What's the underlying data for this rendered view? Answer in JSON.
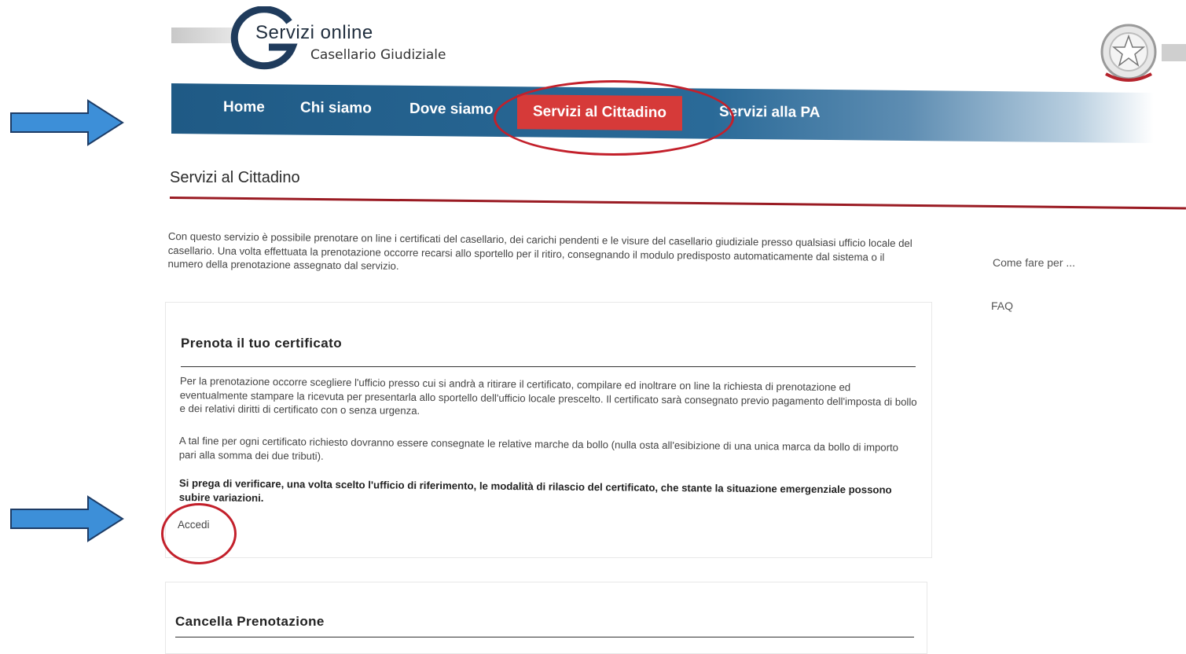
{
  "colors": {
    "nav_blue": "#1f5a85",
    "active_red": "#d63a39",
    "rule_red": "#9a1b23",
    "annotation_red": "#c3202b",
    "arrow_blue": "#3d8fd8"
  },
  "header": {
    "logo_title": "Servizi online",
    "logo_subtitle": "Casellario Giudiziale",
    "logo_icon": "g-logo-icon",
    "emblem_icon": "italian-republic-emblem-icon"
  },
  "nav": {
    "items": [
      {
        "label": "Home"
      },
      {
        "label": "Chi siamo"
      },
      {
        "label": "Dove siamo"
      },
      {
        "label": "Servizi al Cittadino",
        "active": true
      },
      {
        "label": "Servizi alla PA"
      }
    ]
  },
  "page": {
    "title": "Servizi al Cittadino",
    "intro": "Con questo servizio è possibile prenotare on line i certificati del casellario, dei carichi pendenti e le visure del casellario giudiziale presso qualsiasi ufficio locale del casellario. Una volta effettuata la prenotazione occorre recarsi allo sportello per il ritiro, consegnando il modulo predisposto automaticamente dal sistema o il numero della prenotazione assegnato dal servizio."
  },
  "sidebar": {
    "links": [
      {
        "label": "Come fare per ..."
      },
      {
        "label": "FAQ"
      }
    ]
  },
  "panels": [
    {
      "title": "Prenota il tuo certificato",
      "paragraphs": [
        "Per la prenotazione occorre scegliere l'ufficio presso cui si andrà a ritirare il certificato, compilare ed inoltrare on line la richiesta di prenotazione ed eventualmente stampare la ricevuta per presentarla allo sportello dell'ufficio locale prescelto. Il certificato sarà consegnato previo pagamento dell'imposta di bollo e dei relativi diritti di certificato con o senza  urgenza.",
        "A tal fine per ogni certificato richiesto dovranno essere consegnate  le relative marche da bollo (nulla osta all'esibizione di una unica marca da bollo di importo pari alla somma dei due tributi).",
        "Si prega di verificare, una volta scelto l'ufficio di riferimento, le modalità di rilascio del certificato, che stante la situazione emergenziale possono subire variazioni."
      ],
      "link": "Accedi"
    },
    {
      "title": "Cancella Prenotazione"
    }
  ]
}
